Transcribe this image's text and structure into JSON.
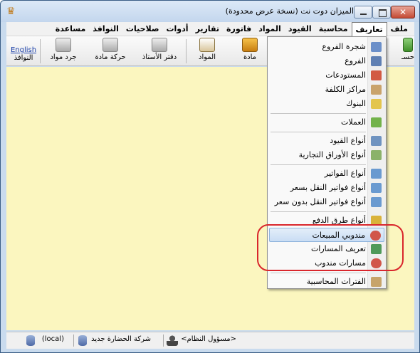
{
  "window": {
    "title": "الميزان دوت نت (نسخة عرض محدودة)"
  },
  "menubar": {
    "items": [
      {
        "label": "ملف"
      },
      {
        "label": "تعاريف",
        "active": true
      },
      {
        "label": "محاسبة"
      },
      {
        "label": "القيود"
      },
      {
        "label": "المواد"
      },
      {
        "label": "فاتورة"
      },
      {
        "label": "تقارير"
      },
      {
        "label": "أدوات"
      },
      {
        "label": "صلاحيات"
      },
      {
        "label": "النوافذ"
      },
      {
        "label": "مساعدة"
      }
    ]
  },
  "toolbar": {
    "english_label": "English",
    "windows_label": "النوافذ",
    "inventory_label": "جرد مواد",
    "material_move_label": "حركة مادة",
    "ledger_label": "دفتر الأستاذ",
    "materials_label": "المواد",
    "material_label": "مادة",
    "accounts_partial_label": "حسـ"
  },
  "dropdown": {
    "items": [
      {
        "label": "شجرة الفروع",
        "icon": "branch-tree-icon",
        "color": "#6b8fc9"
      },
      {
        "label": "الفروع",
        "icon": "branches-icon",
        "color": "#5f7fb3"
      },
      {
        "label": "المستودعات",
        "icon": "warehouse-icon",
        "color": "#d25a43"
      },
      {
        "label": "مراكز الكلفة",
        "icon": "cost-center-icon",
        "color": "#c9a36b"
      },
      {
        "label": "البنوك",
        "icon": "bank-icon",
        "color": "#e3c54d"
      },
      {
        "label": "العملات",
        "icon": "currency-icon",
        "color": "#72b24a"
      },
      {
        "label": "أنواع القيود",
        "icon": "entry-types-icon",
        "color": "#6f93c0"
      },
      {
        "label": "أنواع الأوراق التجارية",
        "icon": "commercial-papers-icon",
        "color": "#8bb26a"
      },
      {
        "label": "أنواع الفواتير",
        "icon": "invoice-types-icon",
        "color": "#6a9ad0"
      },
      {
        "label": "أنواع فواتير النقل بسعر",
        "icon": "transfer-invoice-priced-icon",
        "color": "#6a9ad0"
      },
      {
        "label": "أنواع فواتير النقل بدون سعر",
        "icon": "transfer-invoice-unpriced-icon",
        "color": "#6a9ad0"
      },
      {
        "label": "أنواع طرق الدفع",
        "icon": "payment-methods-icon",
        "color": "#d9b23a"
      },
      {
        "label": "مندوبي المبيعات",
        "icon": "sales-rep-icon",
        "color": "#d1564a"
      },
      {
        "label": "تعريف المسارات",
        "icon": "routes-icon",
        "color": "#4f9a5a"
      },
      {
        "label": "مسارات مندوب",
        "icon": "rep-routes-icon",
        "color": "#d1564a"
      },
      {
        "label": "الفترات المحاسبية",
        "icon": "calendar-icon",
        "color": "#c7a46a"
      }
    ]
  },
  "statusbar": {
    "user": "<مسؤول النظام>",
    "company": "شركة الحضارة جديد",
    "server": "(local)"
  }
}
